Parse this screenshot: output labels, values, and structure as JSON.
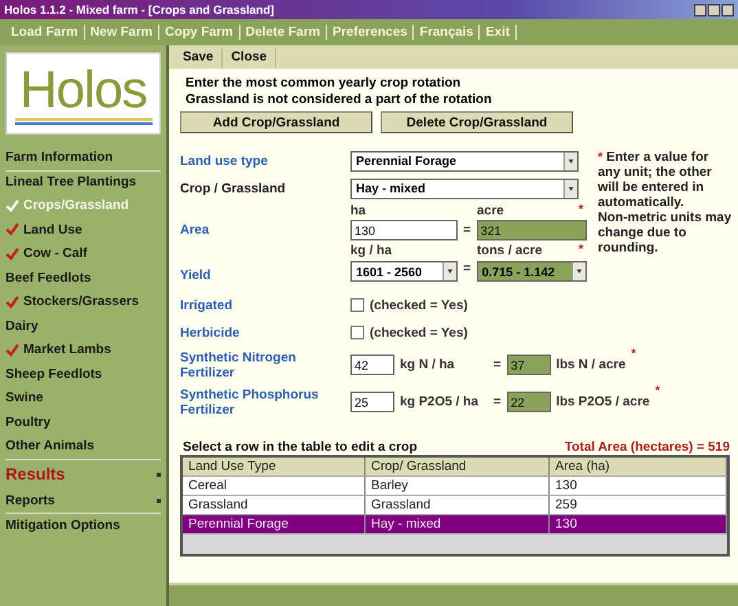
{
  "window": {
    "title": "Holos 1.1.2 - Mixed farm - [Crops and Grassland]"
  },
  "menu": [
    "Load Farm",
    "New Farm",
    "Copy Farm",
    "Delete Farm",
    "Preferences",
    "Français",
    "Exit"
  ],
  "logo": {
    "text": "Holos"
  },
  "sidebar": {
    "items": [
      {
        "label": "Farm Information",
        "kind": "item",
        "checked": false,
        "disabled": false
      },
      {
        "label": "Lineal Tree Plantings",
        "kind": "item",
        "checked": false,
        "disabled": false
      },
      {
        "label": "Crops/Grassland",
        "kind": "item",
        "checked": true,
        "disabled": true
      },
      {
        "label": "Land Use",
        "kind": "item",
        "checked": true,
        "disabled": false
      },
      {
        "label": "Cow - Calf",
        "kind": "item",
        "checked": true,
        "disabled": false
      },
      {
        "label": "Beef Feedlots",
        "kind": "item",
        "checked": false,
        "disabled": false
      },
      {
        "label": "Stockers/Grassers",
        "kind": "item",
        "checked": true,
        "disabled": false
      },
      {
        "label": "Dairy",
        "kind": "item",
        "checked": false,
        "disabled": false
      },
      {
        "label": "Market Lambs",
        "kind": "item",
        "checked": true,
        "disabled": false
      },
      {
        "label": "Sheep Feedlots",
        "kind": "item",
        "checked": false,
        "disabled": false
      },
      {
        "label": "Swine",
        "kind": "item",
        "checked": false,
        "disabled": false
      },
      {
        "label": "Poultry",
        "kind": "item",
        "checked": false,
        "disabled": false
      },
      {
        "label": "Other Animals",
        "kind": "item",
        "checked": false,
        "disabled": false
      },
      {
        "label": "Results",
        "kind": "section",
        "checked": false,
        "disabled": false
      },
      {
        "label": "Reports",
        "kind": "submenu",
        "checked": false,
        "disabled": false
      },
      {
        "label": "Mitigation Options",
        "kind": "item",
        "checked": false,
        "disabled": false
      }
    ]
  },
  "toolbar": [
    "Save",
    "Close"
  ],
  "intro": [
    "Enter the most common yearly crop rotation",
    "Grassland is not considered a part of the rotation"
  ],
  "buttons": [
    "Add Crop/Grassland",
    "Delete Crop/Grassland"
  ],
  "form": {
    "land_use_type": {
      "label": "Land use type",
      "value": "Perennial Forage"
    },
    "crop": {
      "label": "Crop / Grassland",
      "value": "Hay - mixed"
    },
    "area": {
      "label": "Area",
      "unit_1": "ha",
      "unit_2": "acre",
      "value_1": "130",
      "value_2": "321",
      "mark": "*"
    },
    "yield": {
      "label": "Yield",
      "unit_1": "kg / ha",
      "unit_2": "tons / acre",
      "value_1": "1601 - 2560",
      "value_2": "0.715 - 1.142",
      "mark": "*"
    },
    "irrigated": {
      "label": "Irrigated",
      "checked": false,
      "hint": "(checked = Yes)"
    },
    "herbicide": {
      "label": "Herbicide",
      "checked": false,
      "hint": "(checked = Yes)"
    },
    "nitrogen": {
      "label": "Synthetic Nitrogen Fertilizer",
      "value_1": "42",
      "unit_1": "kg N / ha",
      "value_2": "37",
      "unit_2": "lbs N / acre",
      "mark": "*"
    },
    "phosphorus": {
      "label": "Synthetic Phosphorus Fertilizer",
      "value_1": "25",
      "unit_1": "kg P2O5 / ha",
      "value_2": "22",
      "unit_2": "lbs P2O5 / acre",
      "mark": "*"
    }
  },
  "equals": "=",
  "note": {
    "mark": "*",
    "text": "Enter a value for any unit; the other will be entered in automatically.",
    "text_2": "Non-metric units may change due to rounding."
  },
  "table": {
    "caption": "Select a row in the table to edit a crop",
    "total": "Total Area (hectares) = 519",
    "columns": [
      "Land Use Type",
      "Crop/ Grassland",
      "Area (ha)"
    ],
    "rows": [
      {
        "cells": [
          "Cereal",
          "Barley",
          "130"
        ],
        "selected": false
      },
      {
        "cells": [
          "Grassland",
          "Grassland",
          "259"
        ],
        "selected": false
      },
      {
        "cells": [
          "Perennial Forage",
          "Hay - mixed",
          "130"
        ],
        "selected": true
      }
    ]
  }
}
